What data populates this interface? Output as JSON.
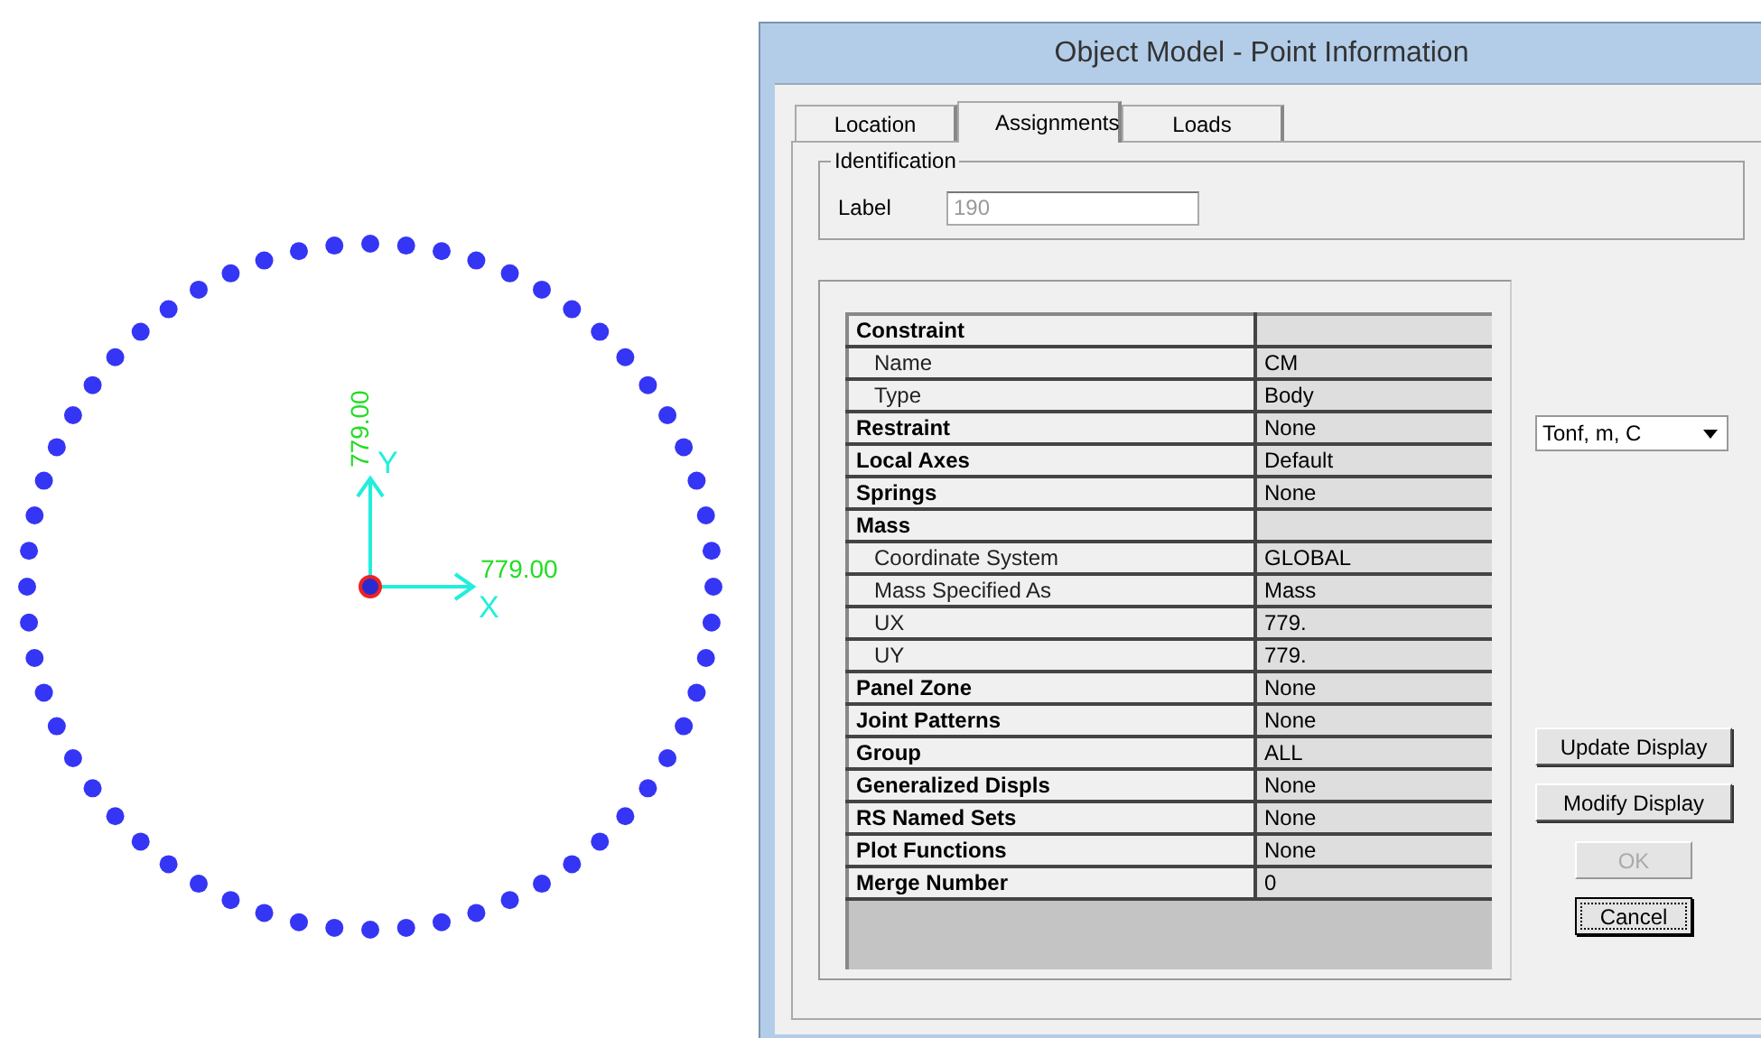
{
  "canvas": {
    "x_axis": {
      "letter": "X",
      "value": "779.00"
    },
    "y_axis": {
      "letter": "Y",
      "value": "779.00"
    }
  },
  "dialog": {
    "title": "Object Model - Point Information",
    "tabs": [
      {
        "label": "Location",
        "selected": false
      },
      {
        "label": "Assignments",
        "selected": true
      },
      {
        "label": "Loads",
        "selected": false
      }
    ],
    "identification": {
      "title": "Identification",
      "label": "Label",
      "value": "190",
      "disabled": true
    },
    "table": {
      "rows": [
        {
          "kind": "header",
          "label": "Constraint"
        },
        {
          "kind": "sub",
          "label": "Name",
          "value": "CM"
        },
        {
          "kind": "sub",
          "label": "Type",
          "value": "Body"
        },
        {
          "kind": "header",
          "label": "Restraint",
          "value": "None"
        },
        {
          "kind": "header",
          "label": "Local Axes",
          "value": "Default"
        },
        {
          "kind": "header",
          "label": "Springs",
          "value": "None"
        },
        {
          "kind": "header",
          "label": "Mass"
        },
        {
          "kind": "sub",
          "label": "Coordinate System",
          "value": "GLOBAL"
        },
        {
          "kind": "sub",
          "label": "Mass Specified As",
          "value": "Mass"
        },
        {
          "kind": "sub",
          "label": "UX",
          "value": "779."
        },
        {
          "kind": "sub",
          "label": "UY",
          "value": "779."
        },
        {
          "kind": "header",
          "label": "Panel Zone",
          "value": "None"
        },
        {
          "kind": "header",
          "label": "Joint Patterns",
          "value": "None"
        },
        {
          "kind": "header",
          "label": "Group",
          "value": "ALL"
        },
        {
          "kind": "header",
          "label": "Generalized Displs",
          "value": "None"
        },
        {
          "kind": "header",
          "label": "RS Named Sets",
          "value": "None"
        },
        {
          "kind": "header",
          "label": "Plot Functions",
          "value": "None"
        },
        {
          "kind": "header",
          "label": "Merge Number",
          "value": "0"
        }
      ]
    },
    "units": {
      "value": "Tonf, m, C"
    },
    "buttons": [
      {
        "label": "Update Display",
        "disabled": false,
        "focused": false
      },
      {
        "label": "Modify Display",
        "disabled": false,
        "focused": false
      },
      {
        "label": "OK",
        "disabled": true,
        "focused": false
      },
      {
        "label": "Cancel",
        "disabled": false,
        "focused": true
      }
    ]
  }
}
